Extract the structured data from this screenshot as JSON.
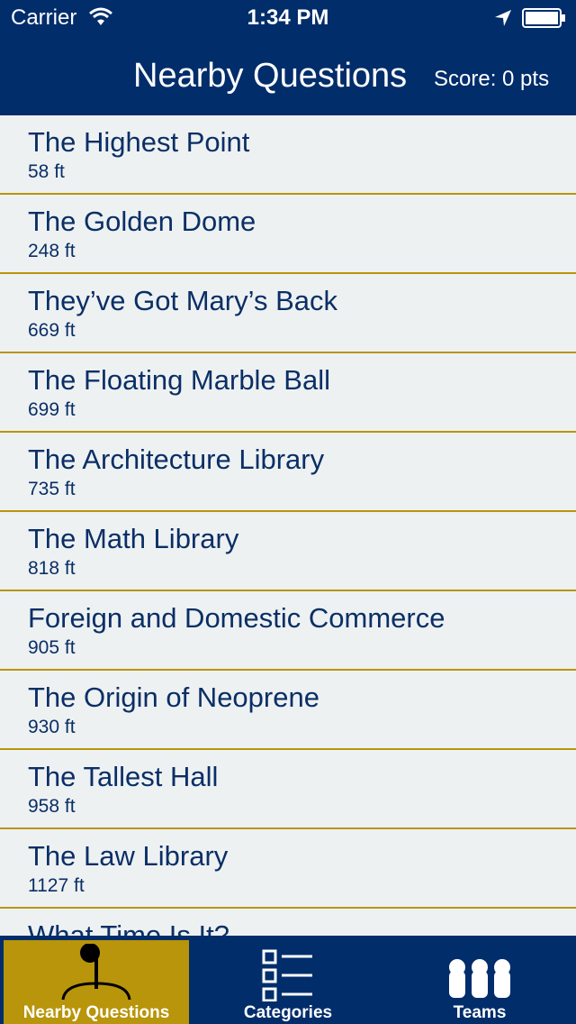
{
  "status_bar": {
    "carrier": "Carrier",
    "time": "1:34 PM"
  },
  "nav": {
    "title": "Nearby Questions",
    "score": "Score: 0 pts"
  },
  "questions": [
    {
      "title": "The Highest Point",
      "distance": "58 ft"
    },
    {
      "title": "The Golden Dome",
      "distance": "248 ft"
    },
    {
      "title": "They’ve Got Mary’s Back",
      "distance": "669 ft"
    },
    {
      "title": "The Floating Marble Ball",
      "distance": "699 ft"
    },
    {
      "title": "The Architecture Library",
      "distance": "735 ft"
    },
    {
      "title": "The Math Library",
      "distance": "818 ft"
    },
    {
      "title": "Foreign and Domestic Commerce",
      "distance": "905 ft"
    },
    {
      "title": "The Origin of Neoprene",
      "distance": "930 ft"
    },
    {
      "title": "The Tallest Hall",
      "distance": "958 ft"
    },
    {
      "title": "The Law Library",
      "distance": "1127 ft"
    },
    {
      "title": "What Time Is It?",
      "distance": ""
    }
  ],
  "tabs": [
    {
      "label": "Nearby Questions",
      "icon": "map-pin-icon",
      "active": true
    },
    {
      "label": "Categories",
      "icon": "list-icon",
      "active": false
    },
    {
      "label": "Teams",
      "icon": "team-icon",
      "active": false
    }
  ],
  "colors": {
    "bar": "#012d6b",
    "accent_gold": "#b8950a",
    "list_bg": "#eef1f2",
    "text": "#0a2f66"
  }
}
